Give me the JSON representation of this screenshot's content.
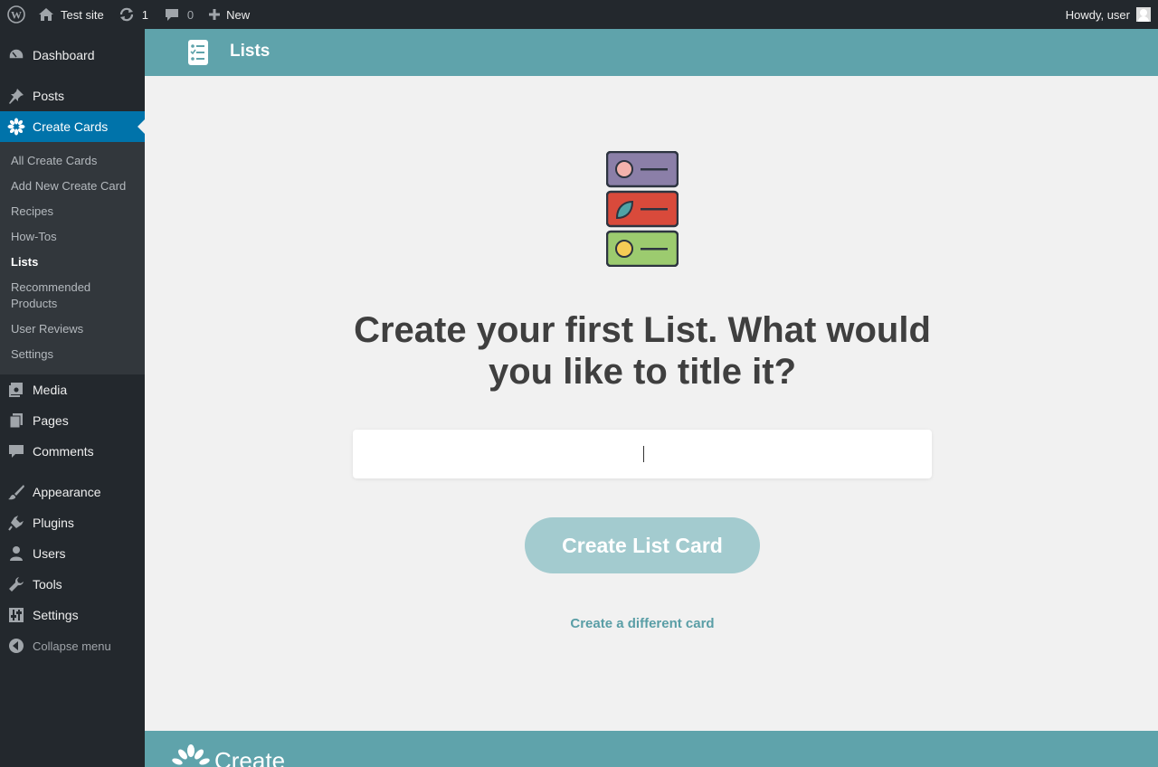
{
  "adminbar": {
    "site_name": "Test site",
    "updates_count": "1",
    "comments_count": "0",
    "new_label": "New",
    "howdy": "Howdy, user"
  },
  "sidebar": {
    "dashboard": "Dashboard",
    "posts": "Posts",
    "create_cards": "Create Cards",
    "submenu": [
      "All Create Cards",
      "Add New Create Card",
      "Recipes",
      "How-Tos",
      "Lists",
      "Recommended Products",
      "User Reviews",
      "Settings"
    ],
    "media": "Media",
    "pages": "Pages",
    "comments": "Comments",
    "appearance": "Appearance",
    "plugins": "Plugins",
    "users": "Users",
    "tools": "Tools",
    "settings": "Settings",
    "collapse": "Collapse menu"
  },
  "header": {
    "title": "Lists",
    "icon": "list-icon"
  },
  "main": {
    "prompt": "Create your first List. What would you like to title it?",
    "title_input_value": "",
    "create_button": "Create List Card",
    "different_card_link": "Create a different card"
  },
  "footer": {
    "brand": "Create"
  },
  "colors": {
    "adminbar_bg": "#23282d",
    "menu_active": "#0073aa",
    "accent_teal": "#5fa3ab",
    "button_disabled": "#a3cbcf"
  }
}
